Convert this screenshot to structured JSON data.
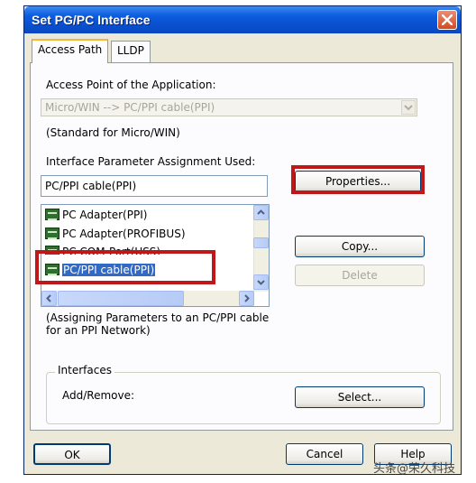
{
  "window": {
    "title": "Set PG/PC Interface"
  },
  "tabs": [
    {
      "label": "Access Path"
    },
    {
      "label": "LLDP"
    }
  ],
  "access_point": {
    "label": "Access Point of the Application:",
    "value": "Micro/WIN      --> PC/PPI cable(PPI)",
    "note": "(Standard for Micro/WIN)"
  },
  "interface": {
    "label": "Interface Parameter Assignment Used:",
    "value": "PC/PPI cable(PPI)",
    "items": [
      {
        "label": "PC Adapter(PPI)"
      },
      {
        "label": "PC Adapter(PROFIBUS)"
      },
      {
        "label": "PC COM-Port(USS)"
      },
      {
        "label": "PC/PPI cable(PPI)"
      }
    ],
    "description": "(Assigning Parameters to an PC/PPI cable for an PPI Network)"
  },
  "buttons": {
    "properties": "Properties...",
    "copy": "Copy...",
    "delete": "Delete",
    "select": "Select...",
    "ok": "OK",
    "cancel": "Cancel",
    "help": "Help"
  },
  "interfaces_group": {
    "title": "Interfaces",
    "add_remove": "Add/Remove:"
  },
  "watermark": "头条@荣久科技",
  "colors": {
    "highlight_box": "#c01818",
    "titlebar": "#0a4fcf",
    "selection": "#316ac5"
  }
}
